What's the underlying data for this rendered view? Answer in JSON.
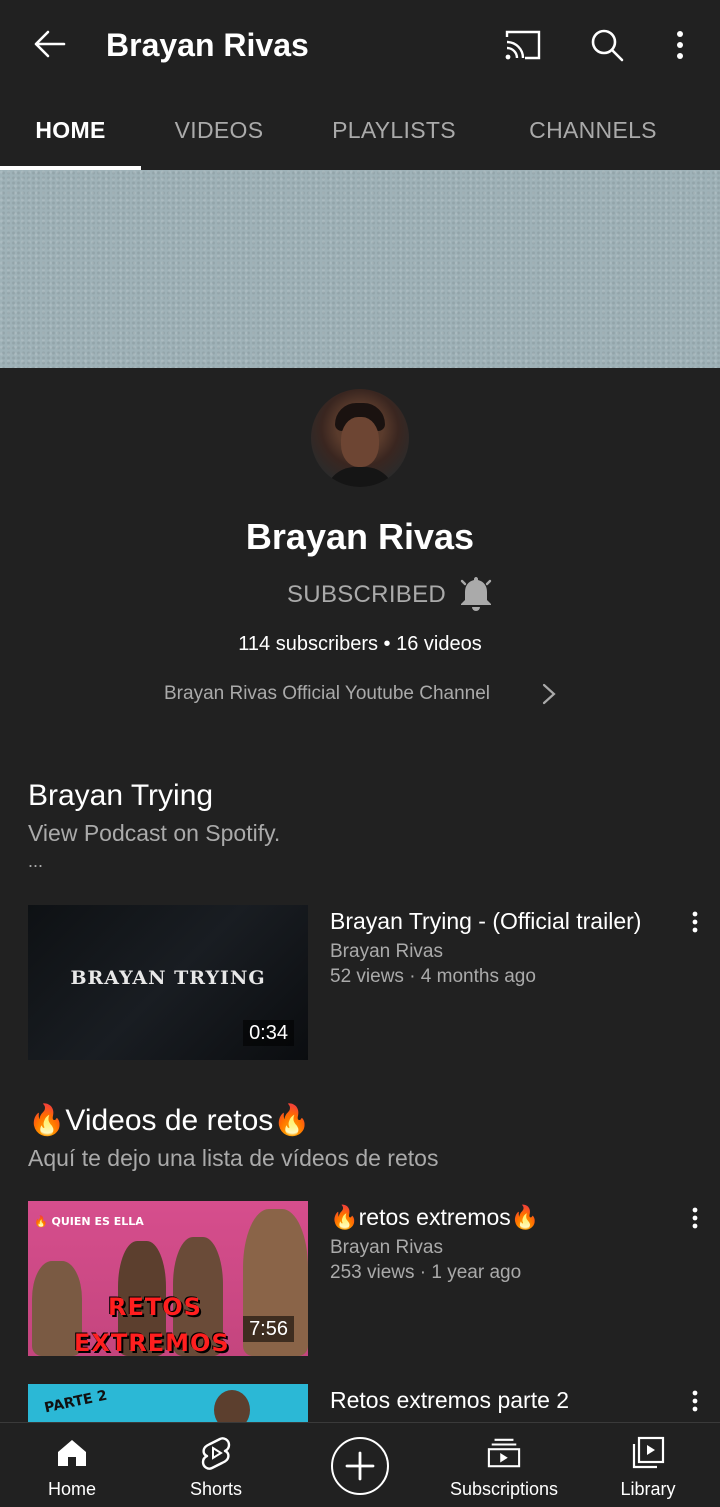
{
  "header": {
    "title": "Brayan Rivas",
    "back_icon": "arrow-left-icon",
    "cast_icon": "cast-icon",
    "search_icon": "search-icon",
    "more_icon": "more-vertical-icon"
  },
  "tabs": [
    {
      "label": "HOME",
      "active": true
    },
    {
      "label": "VIDEOS",
      "active": false
    },
    {
      "label": "PLAYLISTS",
      "active": false
    },
    {
      "label": "CHANNELS",
      "active": false
    }
  ],
  "channel": {
    "name": "Brayan Rivas",
    "subscribe_label": "SUBSCRIBED",
    "stats": "114 subscribers • 16 videos",
    "description": "Brayan Rivas Official Youtube Channel"
  },
  "sections": [
    {
      "title": "Brayan Trying",
      "subtitle": "View Podcast on Spotify.",
      "ellipsis": "...",
      "videos": [
        {
          "thumb_text": "BRAYAN TRYING",
          "duration": "0:34",
          "title": "Brayan Trying - (Official trailer)",
          "channel": "Brayan Rivas",
          "meta": "52 views · 4 months ago"
        }
      ]
    },
    {
      "title": "🔥Videos de retos🔥",
      "subtitle": "Aquí te dejo una lista de vídeos de retos",
      "videos": [
        {
          "thumb_label": "🔥 QUIEN ES ELLA",
          "thumb_word1": "RETOS",
          "thumb_word2": "EXTREMOS",
          "duration": "7:56",
          "title": "🔥retos extremos🔥",
          "channel": "Brayan Rivas",
          "meta": "253 views · 1 year ago"
        },
        {
          "thumb_label": "PARTE 2",
          "title": "Retos extremos  parte 2"
        }
      ]
    }
  ],
  "bottom_nav": [
    {
      "label": "Home",
      "icon": "home-icon"
    },
    {
      "label": "Shorts",
      "icon": "shorts-icon"
    },
    {
      "label": "",
      "icon": "create-plus-icon"
    },
    {
      "label": "Subscriptions",
      "icon": "subscriptions-icon"
    },
    {
      "label": "Library",
      "icon": "library-icon"
    }
  ],
  "colors": {
    "background": "#212121",
    "text_primary": "#ffffff",
    "text_secondary": "#aaaaaa",
    "banner": "#9fb2b8"
  }
}
